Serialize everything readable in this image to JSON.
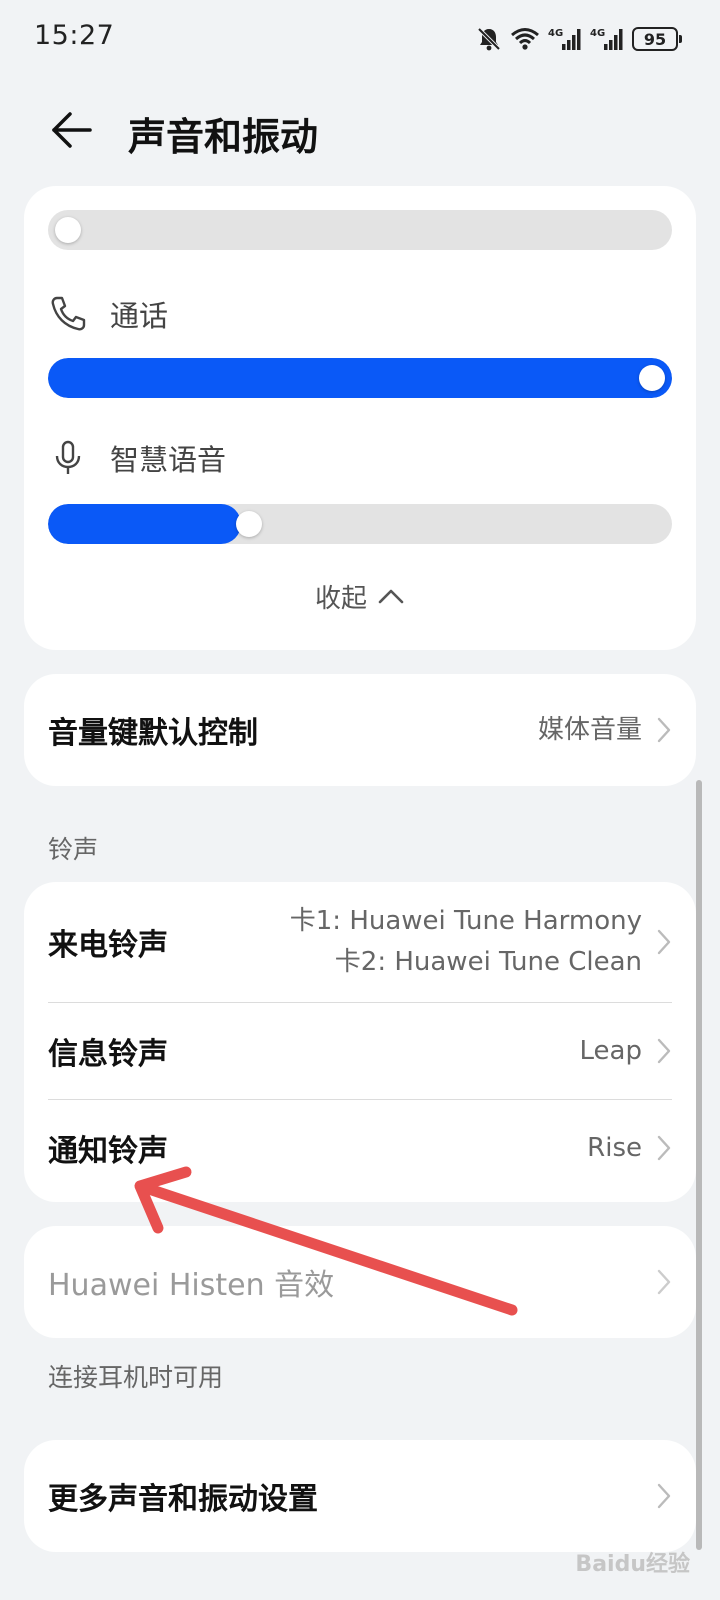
{
  "status": {
    "time": "15:27",
    "battery": "95",
    "network_label": "4G"
  },
  "header": {
    "title": "声音和振动"
  },
  "volume": {
    "top_slider_level": 0,
    "call": {
      "label": "通话",
      "level": 1.0
    },
    "assistant": {
      "label": "智慧语音",
      "level": 0.31
    },
    "collapse_label": "收起"
  },
  "volume_key": {
    "title": "音量键默认控制",
    "value": "媒体音量"
  },
  "ringtones": {
    "section_label": "铃声",
    "items": [
      {
        "title": "来电铃声",
        "value_line1": "卡1: Huawei Tune Harmony",
        "value_line2": "卡2: Huawei Tune Clean"
      },
      {
        "title": "信息铃声",
        "value": "Leap"
      },
      {
        "title": "通知铃声",
        "value": "Rise"
      }
    ]
  },
  "histen": {
    "title": "Huawei Histen 音效",
    "note": "连接耳机时可用"
  },
  "more": {
    "title": "更多声音和振动设置"
  },
  "watermark": "Baidu经验",
  "colors": {
    "accent": "#0a59f7",
    "annotation_arrow": "#e8504f",
    "background": "#f1f3f5"
  }
}
